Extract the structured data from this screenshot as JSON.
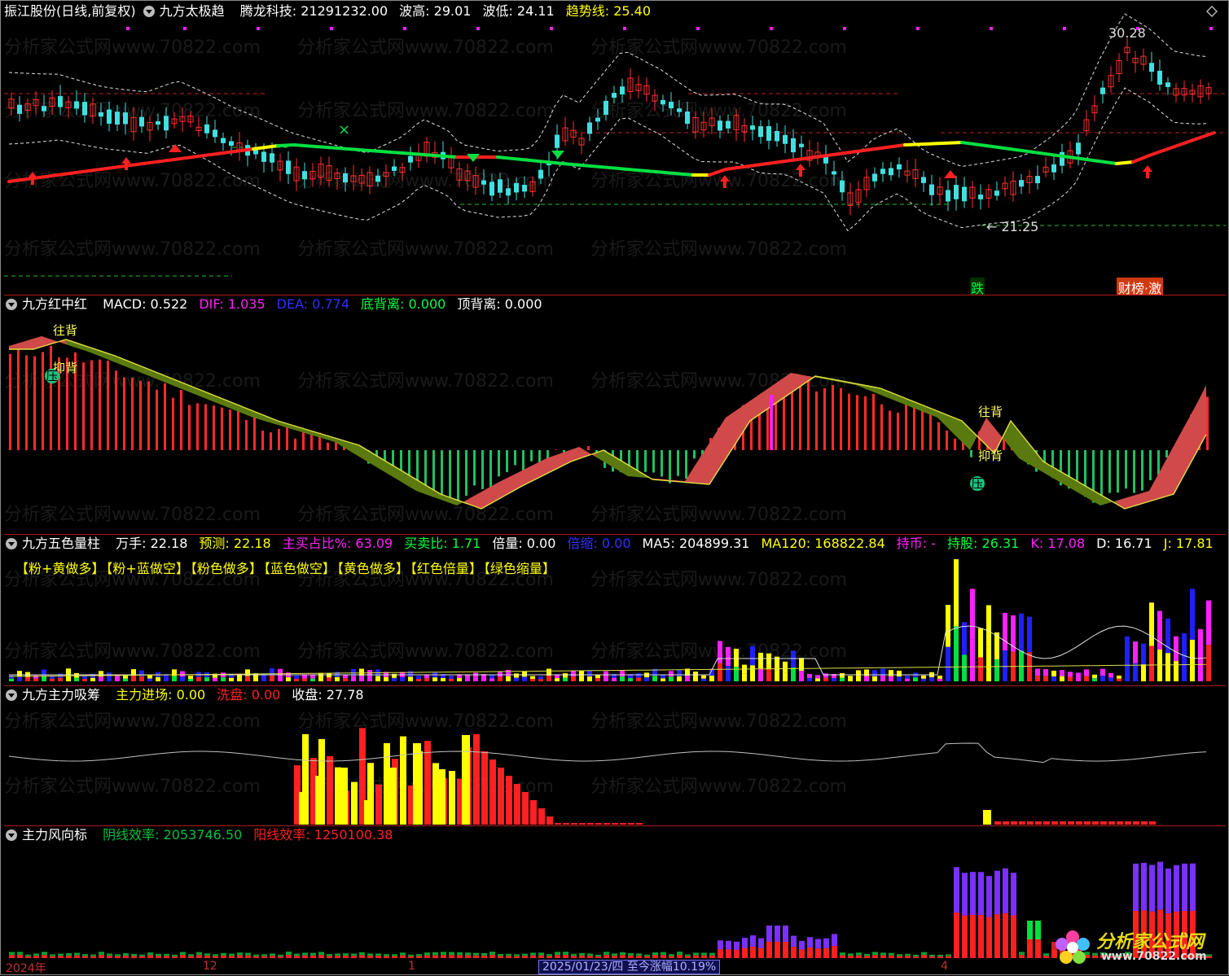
{
  "colors": {
    "red": "#ff2020",
    "green": "#00e040",
    "yellow": "#ffff00",
    "pink": "#ff20ff",
    "blue": "#2020ff",
    "cyan": "#00e0e0",
    "white": "#e0e0e0"
  },
  "watermark": "分析家公式网www.70822.com",
  "panel1": {
    "stock_label": "振江股份(日线,前复权)",
    "indicator_name": "九方太极趋",
    "items": [
      {
        "label": "腾龙科技: 21291232.00",
        "color": "#ffffff"
      },
      {
        "label": "波高: 29.01",
        "color": "#ffffff"
      },
      {
        "label": "波低: 24.11",
        "color": "#ffffff"
      },
      {
        "label": "趋势线: 25.40",
        "color": "#ffff00"
      }
    ],
    "price_high_label": "30.28",
    "price_low_label": "21.25",
    "badge_fall": "跌",
    "badge_hot": "财榜·激",
    "corner_icon": "diamond-icon"
  },
  "panel2": {
    "indicator_name": "九方红中红",
    "items": [
      {
        "label": "MACD: 0.522",
        "color": "#ffffff"
      },
      {
        "label": "DIF: 1.035",
        "color": "#ff20ff"
      },
      {
        "label": "DEA: 0.774",
        "color": "#3030ff"
      },
      {
        "label": "底背离: 0.000",
        "color": "#00ff40"
      },
      {
        "label": "顶背离: 0.000",
        "color": "#ffffff"
      }
    ],
    "markers": [
      "往背",
      "抑背",
      "压",
      "往背",
      "抑背",
      "压"
    ]
  },
  "panel3": {
    "indicator_name": "九方五色量柱",
    "items": [
      {
        "label": "万手: 22.18",
        "color": "#ffffff"
      },
      {
        "label": "预测: 22.18",
        "color": "#ffff00"
      },
      {
        "label": "主买占比%: 63.09",
        "color": "#ff20ff"
      },
      {
        "label": "买卖比: 1.71",
        "color": "#00ff40"
      },
      {
        "label": "倍量: 0.00",
        "color": "#ffffff"
      },
      {
        "label": "倍缩: 0.00",
        "color": "#3030ff"
      },
      {
        "label": "MA5: 204899.31",
        "color": "#ffffff"
      },
      {
        "label": "MA120: 168822.84",
        "color": "#ffff00"
      },
      {
        "label": "持币: -",
        "color": "#ff20ff"
      },
      {
        "label": "持股: 26.31",
        "color": "#00ff40"
      },
      {
        "label": "K: 17.08",
        "color": "#ff20ff"
      },
      {
        "label": "D: 16.71",
        "color": "#ffffff"
      },
      {
        "label": "J: 17.81",
        "color": "#ffff00"
      }
    ],
    "legend": [
      "【粉+黄做多】",
      "【粉+蓝做空】",
      "【粉色做多】",
      "【蓝色做空】",
      "【黄色做多】",
      "【红色倍量】",
      "【绿色缩量】"
    ]
  },
  "panel4": {
    "indicator_name": "九方主力吸筹",
    "items": [
      {
        "label": "主力进场: 0.00",
        "color": "#ffff00"
      },
      {
        "label": "洗盘: 0.00",
        "color": "#ff2020"
      },
      {
        "label": "收盘: 27.78",
        "color": "#ffffff"
      }
    ]
  },
  "panel5": {
    "indicator_name": "主力风向标",
    "items": [
      {
        "label": "阴线效率: 2053746.50",
        "color": "#00c040"
      },
      {
        "label": "阳线效率: 1250100.38",
        "color": "#ff2020"
      }
    ]
  },
  "xaxis": {
    "labels": [
      "2024年",
      "12",
      "1",
      "4"
    ],
    "date_box": "2025/01/23/四  至今涨幅10.19%"
  },
  "logo": {
    "title": "分析家公式网",
    "url": "www.70822.com"
  }
}
